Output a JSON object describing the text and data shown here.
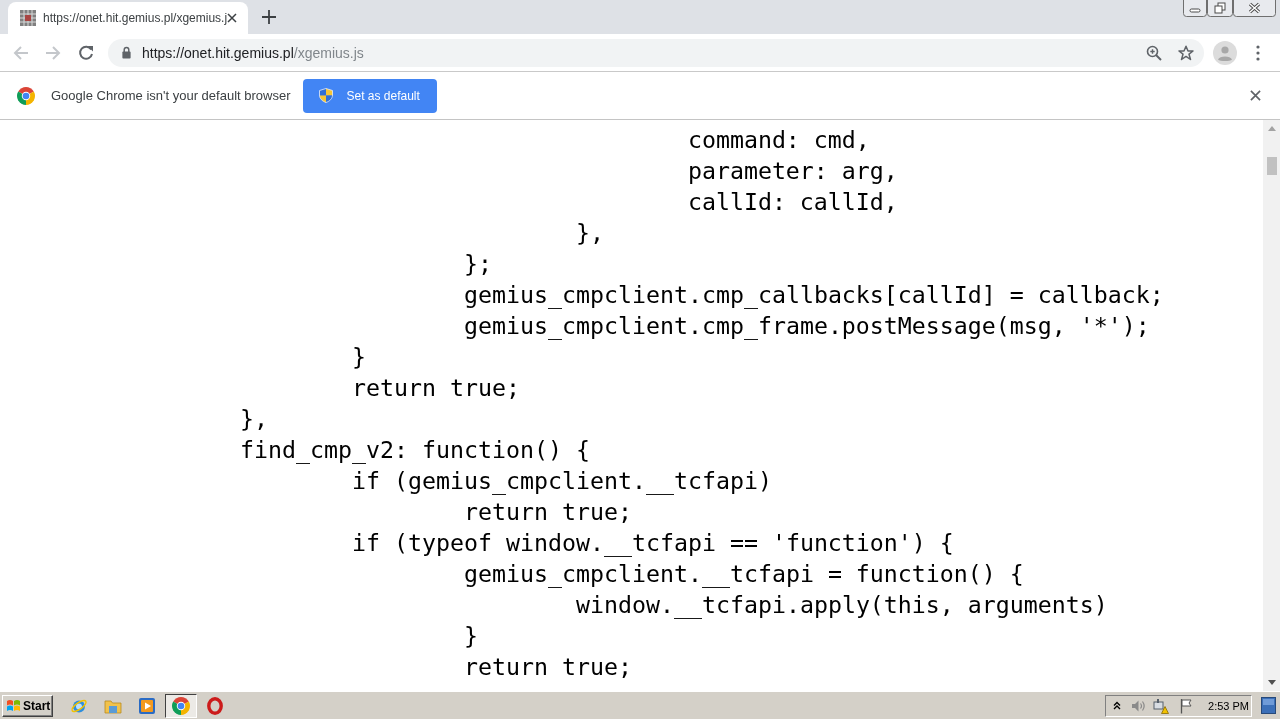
{
  "browser": {
    "tabs": [
      {
        "title": "https://onet.hit.gemius.pl/xgemius.j",
        "selected": true
      }
    ]
  },
  "toolbar": {
    "back": {
      "disabled": true
    },
    "forward": {
      "disabled": true
    },
    "address": {
      "host": "https://onet.hit.gemius.pl",
      "path": "/xgemius.js"
    }
  },
  "infobar": {
    "message": "Google Chrome isn't your default browser",
    "button": "Set as default"
  },
  "source_code": {
    "lines": [
      "\t\t\t\t\t\tcommand: cmd,",
      "\t\t\t\t\t\tparameter: arg,",
      "\t\t\t\t\t\tcallId: callId,",
      "\t\t\t\t\t},",
      "\t\t\t\t};",
      "\t\t\t\tgemius_cmpclient.cmp_callbacks[callId] = callback;",
      "\t\t\t\tgemius_cmpclient.cmp_frame.postMessage(msg, '*');",
      "\t\t\t}",
      "\t\t\treturn true;",
      "\t\t},",
      "\t\tfind_cmp_v2: function() {",
      "\t\t\tif (gemius_cmpclient.__tcfapi)",
      "\t\t\t\treturn true;",
      "\t\t\tif (typeof window.__tcfapi == 'function') {",
      "\t\t\t\tgemius_cmpclient.__tcfapi = function() {",
      "\t\t\t\t\twindow.__tcfapi.apply(this, arguments)",
      "\t\t\t\t}",
      "\t\t\t\treturn true;"
    ]
  },
  "taskbar": {
    "start": "Start",
    "apps": [
      {
        "kind": "ie",
        "selected": false
      },
      {
        "kind": "explorer",
        "selected": false
      },
      {
        "kind": "media",
        "selected": false
      },
      {
        "kind": "chrome",
        "selected": true
      },
      {
        "kind": "opera",
        "selected": false
      }
    ],
    "clock": "2:53 PM"
  }
}
